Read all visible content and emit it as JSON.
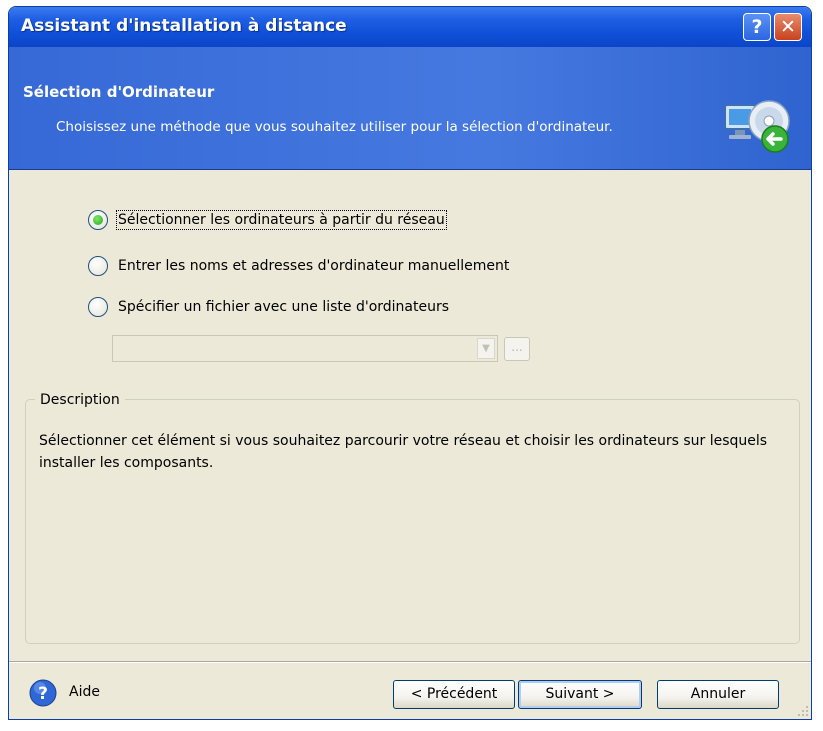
{
  "window": {
    "title": "Assistant d'installation à distance",
    "help_button": "?",
    "close_button": "✕"
  },
  "header": {
    "title": "Sélection d'Ordinateur",
    "subtitle": "Choisissez une méthode que vous souhaitez utiliser pour la sélection d'ordinateur."
  },
  "options": [
    {
      "label": "Sélectionner les ordinateurs à partir du réseau",
      "checked": true
    },
    {
      "label": "Entrer les noms et adresses d'ordinateur manuellement",
      "checked": false
    },
    {
      "label": "Spécifier un fichier avec une liste d'ordinateurs",
      "checked": false
    }
  ],
  "file_combo": {
    "value": "",
    "browse_label": "..."
  },
  "description": {
    "legend": "Description",
    "text": "Sélectionner cet élément si vous souhaitez parcourir votre réseau et choisir les ordinateurs sur lesquels installer les composants."
  },
  "footer": {
    "help_label": "Aide",
    "prev_label": "< Précédent",
    "next_label": "Suivant >",
    "cancel_label": "Annuler"
  },
  "colors": {
    "titlebar": "#0f4fd8",
    "header": "#4679e0",
    "dialog_bg": "#ece9d8",
    "radio_checked": "#2aa51d",
    "close_button": "#c8421c"
  }
}
